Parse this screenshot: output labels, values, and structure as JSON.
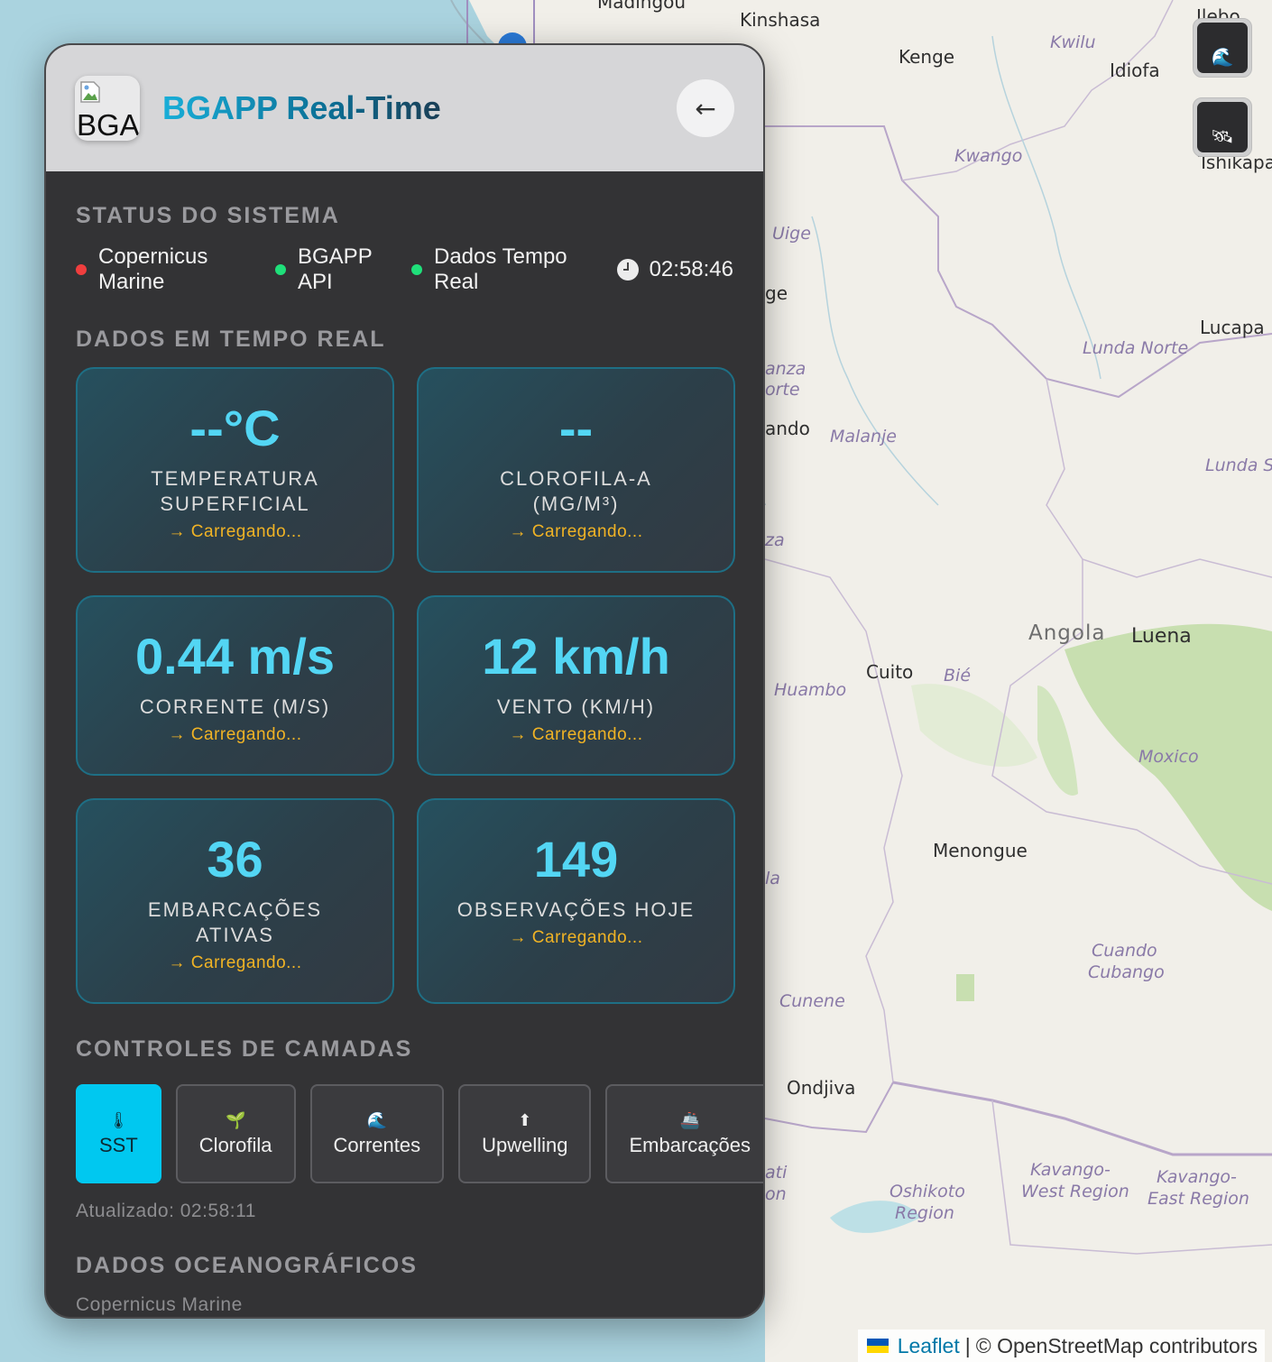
{
  "map": {
    "places": {
      "madingou": "Madingou",
      "kinshasa": "Kinshasa",
      "kenge": "Kenge",
      "kwilu": "Kwilu",
      "idiofa": "Idiofa",
      "ilebo": "Ilebo",
      "tshikapa": "Tshikapa",
      "kwango": "Kwango",
      "uige": "Uige",
      "ge_partial": "ge",
      "lucapa": "Lucapa",
      "lunda_norte": "Lunda Norte",
      "anza_partial": "anza",
      "orte_partial": "orte",
      "ando_partial": "ando",
      "malanje": "Malanje",
      "lunda_sul": "Lunda Su",
      "za_partial": "za",
      "angola": "Angola",
      "luena": "Luena",
      "cuito": "Cuito",
      "bie": "Bié",
      "huambo": "Huambo",
      "moxico": "Moxico",
      "menongue": "Menongue",
      "la_partial": "la",
      "cuando_cubango_1": "Cuando",
      "cuando_cubango_2": "Cubango",
      "cunene": "Cunene",
      "ondjiva": "Ondjiva",
      "ati_partial": "ati",
      "on_partial": "on",
      "oshikoto_1": "Oshikoto",
      "oshikoto_2": "Region",
      "kavango_west_1": "Kavango-",
      "kavango_west_2": "West Region",
      "kavango_east_1": "Kavango-",
      "kavango_east_2": "East Region"
    },
    "controls": [
      {
        "icon": "wave-icon",
        "glyph": "🌊"
      },
      {
        "icon": "satellite-icon",
        "glyph": "🛰"
      }
    ],
    "attribution": {
      "leaflet": "Leaflet",
      "separator": "|",
      "osm": "© OpenStreetMap contributors"
    },
    "colors": {
      "land": "#f1efe9",
      "water": "#aad3df",
      "forest": "#c8dfb0",
      "border": "#a08fc0"
    }
  },
  "panel": {
    "title": "BGAPP Real-Time",
    "logo_alt": "BGA",
    "back_glyph": "←",
    "status": {
      "heading": "Status do Sistema",
      "items": [
        {
          "line1": "Copernicus",
          "line2": "Marine",
          "color": "#f03e3e"
        },
        {
          "line1": "BGAPP",
          "line2": "API",
          "color": "#1fe07a"
        },
        {
          "line1": "Dados Tempo",
          "line2": "Real",
          "color": "#1fe07a"
        }
      ],
      "clock": "02:58:46"
    },
    "realtime": {
      "heading": "Dados em Tempo Real",
      "cards": [
        {
          "value": "--°C",
          "label": "Temperatura Superficial",
          "sub": "→ Carregando..."
        },
        {
          "value": "--",
          "label": "Clorofila-a (mg/m³)",
          "sub": "→ Carregando..."
        },
        {
          "value": "0.44 m/s",
          "label": "Corrente (m/s)",
          "sub": "→ Carregando..."
        },
        {
          "value": "12 km/h",
          "label": "Vento (km/h)",
          "sub": "→ Carregando..."
        },
        {
          "value": "36",
          "label": "Embarcações Ativas",
          "sub": "→ Carregando..."
        },
        {
          "value": "149",
          "label": "Observações Hoje",
          "sub": "→ Carregando..."
        }
      ]
    },
    "layers": {
      "heading": "Controles de Camadas",
      "buttons": [
        {
          "label": "SST",
          "icon": "thermometer-icon",
          "glyph": "🌡",
          "active": true
        },
        {
          "label": "Clorofila",
          "icon": "seedling-icon",
          "glyph": "🌱",
          "active": false
        },
        {
          "label": "Correntes",
          "icon": "wave-icon",
          "glyph": "🌊",
          "active": false
        },
        {
          "label": "Upwelling",
          "icon": "arrow-up-icon",
          "glyph": "⬆",
          "active": false
        },
        {
          "label": "Embarcações",
          "icon": "ship-icon",
          "glyph": "🚢",
          "active": false
        }
      ],
      "updated": "Atualizado: 02:58:11"
    },
    "ocean": {
      "heading": "Dados Oceanográficos",
      "source": "Copernicus Marine"
    }
  }
}
